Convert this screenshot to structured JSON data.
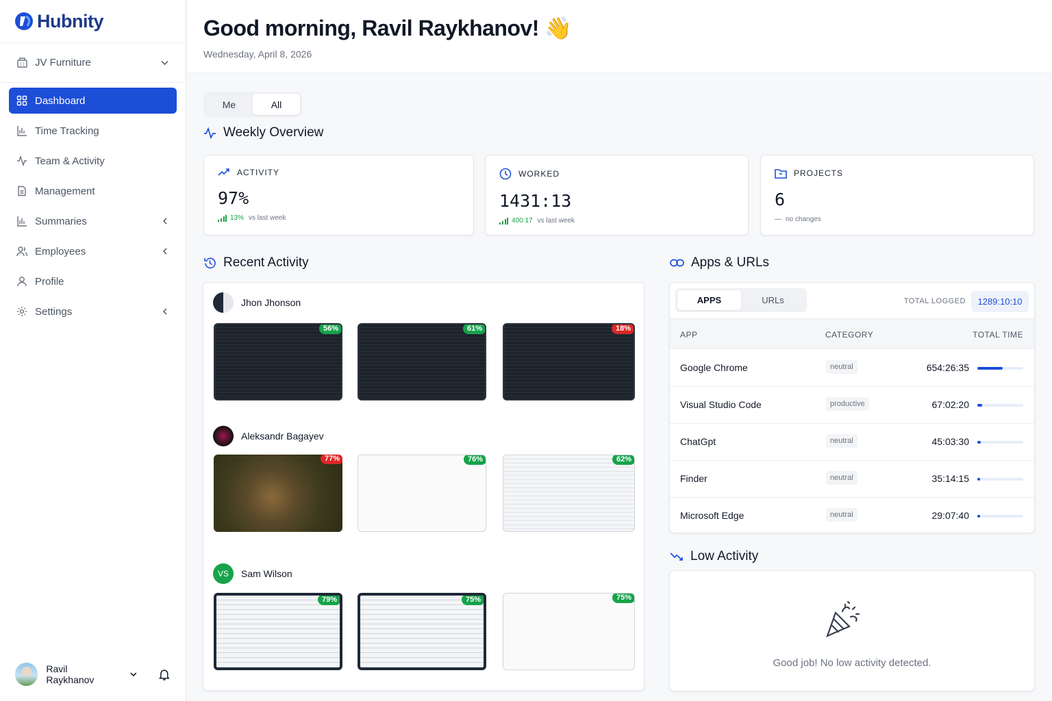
{
  "brand": {
    "name": "Hubnity"
  },
  "workspace": {
    "name": "JV Furniture"
  },
  "nav": [
    {
      "label": "Dashboard",
      "icon": "grid-icon"
    },
    {
      "label": "Time Tracking",
      "icon": "bar-chart-icon"
    },
    {
      "label": "Team & Activity",
      "icon": "activity-icon"
    },
    {
      "label": "Management",
      "icon": "document-icon"
    },
    {
      "label": "Summaries",
      "icon": "bar-chart-icon"
    },
    {
      "label": "Employees",
      "icon": "users-icon"
    },
    {
      "label": "Profile",
      "icon": "user-icon"
    },
    {
      "label": "Settings",
      "icon": "gear-icon"
    }
  ],
  "user": {
    "name": "Ravil Raykhanov"
  },
  "header": {
    "greeting": "Good morning, Ravil Raykhanov!",
    "emoji": "👋",
    "date": "Wednesday, April 8, 2026"
  },
  "scope_toggle": {
    "me": "Me",
    "all": "All",
    "selected": "All"
  },
  "weekly": {
    "title": "Weekly Overview",
    "activity": {
      "label": "ACTIVITY",
      "value": "97%",
      "delta": "13%",
      "note": "vs last week"
    },
    "worked": {
      "label": "WORKED",
      "value": "1431:13",
      "delta": "400:17",
      "note": "vs last week"
    },
    "projects": {
      "label": "PROJECTS",
      "value": "6",
      "note": "no changes"
    }
  },
  "recent": {
    "title": "Recent Activity",
    "people": [
      {
        "name": "Jhon Jhonson",
        "shots": [
          "56%",
          "61%",
          "18%"
        ]
      },
      {
        "name": "Aleksandr Bagayev",
        "shots": [
          "77%",
          "76%",
          "62%"
        ]
      },
      {
        "name": "Sam Wilson",
        "initials": "VS",
        "shots": [
          "79%",
          "75%",
          "75%"
        ]
      }
    ]
  },
  "apps": {
    "title": "Apps & URLs",
    "tab_apps": "APPS",
    "tab_urls": "URLs",
    "total_label": "TOTAL LOGGED",
    "total_value": "1289:10:10",
    "col_app": "APP",
    "col_category": "CATEGORY",
    "col_time": "TOTAL TIME",
    "rows": [
      {
        "app": "Google Chrome",
        "category": "neutral",
        "time": "654:26:35",
        "share": 0.55
      },
      {
        "app": "Visual Studio Code",
        "category": "productive",
        "time": "67:02:20",
        "share": 0.1
      },
      {
        "app": "ChatGpt",
        "category": "neutral",
        "time": "45:03:30",
        "share": 0.07
      },
      {
        "app": "Finder",
        "category": "neutral",
        "time": "35:14:15",
        "share": 0.05
      },
      {
        "app": "Microsoft Edge",
        "category": "neutral",
        "time": "29:07:40",
        "share": 0.04
      }
    ]
  },
  "low": {
    "title": "Low Activity",
    "message": "Good job! No low activity detected."
  },
  "colors": {
    "accent": "#1d4ed8",
    "good": "#16a34a",
    "bad": "#dc2626"
  }
}
